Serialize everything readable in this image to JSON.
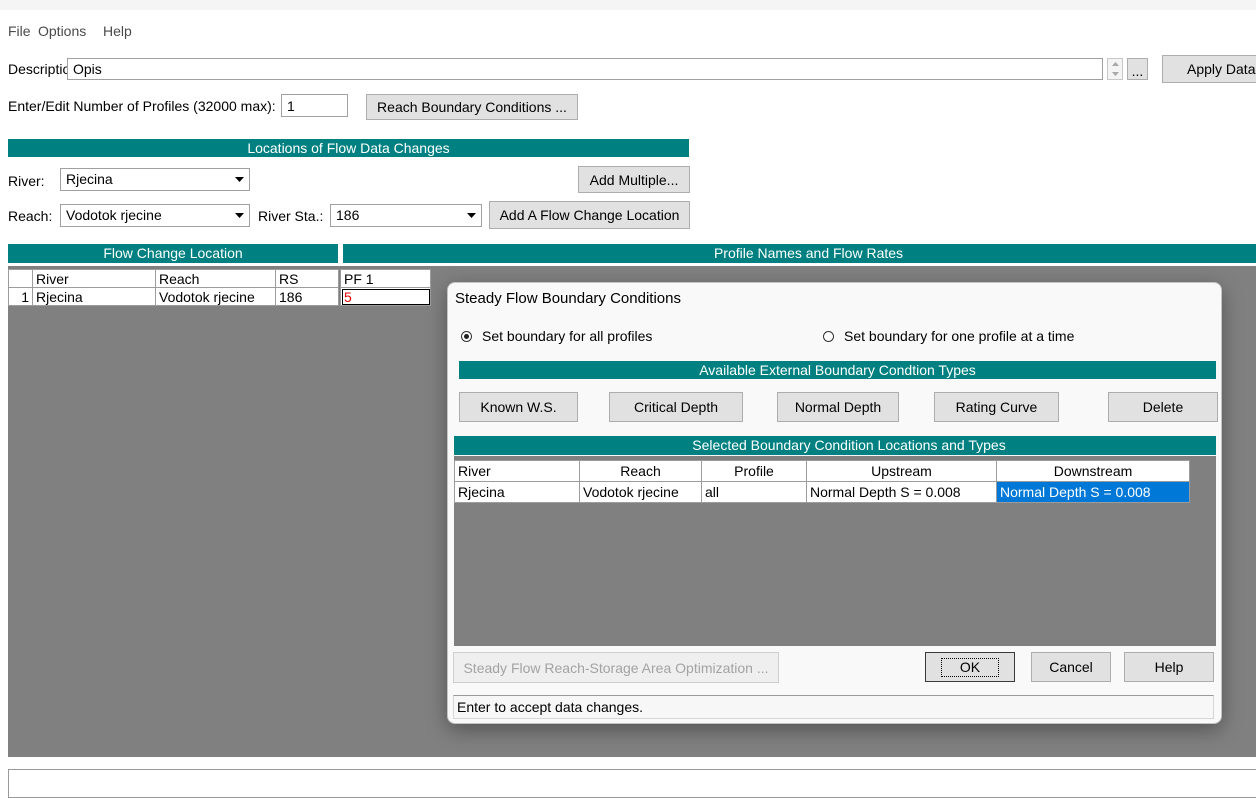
{
  "menu": {
    "items": [
      "File",
      "Options",
      "Help"
    ]
  },
  "description": {
    "label": "Description :",
    "value": "Opis",
    "ellipsis_label": "...",
    "apply_label": "Apply Data"
  },
  "profiles": {
    "label": "Enter/Edit Number of Profiles (32000 max):",
    "value": "1",
    "reach_bc_label": "Reach Boundary Conditions ..."
  },
  "locations": {
    "header": "Locations of Flow Data Changes",
    "river_label": "River:",
    "river_value": "Rjecina",
    "add_multiple_label": "Add Multiple...",
    "reach_label": "Reach:",
    "reach_value": "Vodotok rjecine",
    "river_sta_label": "River Sta.:",
    "river_sta_value": "186",
    "add_location_label": "Add A Flow Change Location"
  },
  "flow_table": {
    "left_header": "Flow Change Location",
    "right_header": "Profile Names and Flow Rates",
    "columns": {
      "river": "River",
      "reach": "Reach",
      "rs": "RS",
      "pf1": "PF 1"
    },
    "rows": [
      {
        "index": "1",
        "river": "Rjecina",
        "reach": "Vodotok rjecine",
        "rs": "186",
        "pf1": "5",
        "pf1_active": true
      }
    ]
  },
  "dialog": {
    "title": "Steady Flow Boundary Conditions",
    "mode": {
      "all_label": "Set boundary for all profiles",
      "all_checked": true,
      "one_label": "Set boundary for one profile at a time",
      "one_checked": false
    },
    "types": {
      "header": "Available External Boundary Condtion Types",
      "buttons": [
        "Known W.S.",
        "Critical Depth",
        "Normal Depth",
        "Rating Curve",
        "Delete"
      ]
    },
    "table": {
      "header": "Selected Boundary Condition Locations and Types",
      "columns": {
        "river": "River",
        "reach": "Reach",
        "profile": "Profile",
        "upstream": "Upstream",
        "downstream": "Downstream"
      },
      "rows": [
        {
          "river": "Rjecina",
          "reach": "Vodotok rjecine",
          "profile": "all",
          "upstream": "Normal Depth S = 0.008",
          "downstream": "Normal Depth S = 0.008",
          "downstream_selected": true
        }
      ]
    },
    "optimization_label": "Steady Flow Reach-Storage Area Optimization ...",
    "ok_label": "OK",
    "cancel_label": "Cancel",
    "help_label": "Help",
    "status": "Enter to accept data changes."
  },
  "icons": {
    "combo_arrow": "chevron-down-icon",
    "spinner_up": "spinner-up-icon",
    "spinner_down": "spinner-down-icon",
    "radio": "radio-button-icon"
  },
  "colors": {
    "header_teal": "#008080",
    "grid_background": "#808080",
    "selection": "#0078d7",
    "flow_value": "#e00000"
  }
}
